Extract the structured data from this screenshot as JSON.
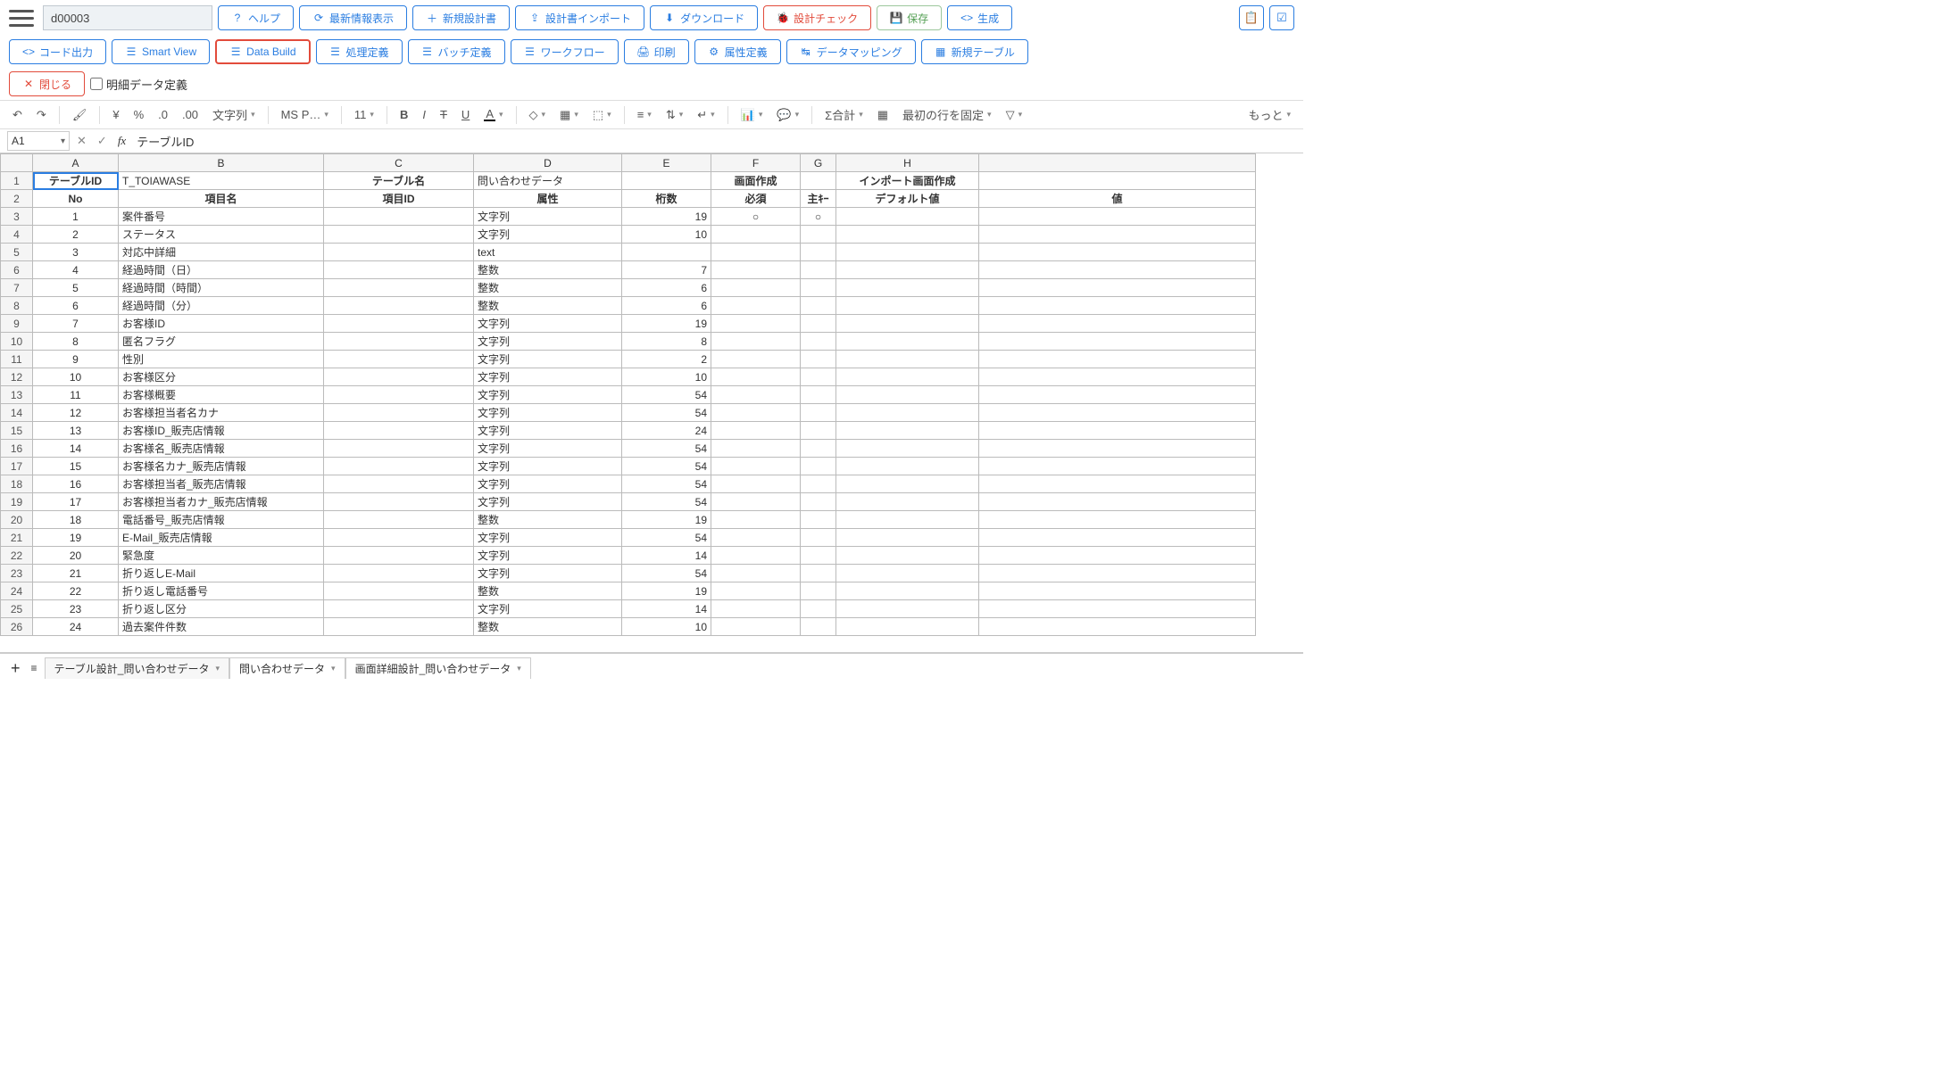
{
  "header": {
    "id_value": "d00003",
    "buttons": {
      "help": "ヘルプ",
      "refresh": "最新情報表示",
      "newdoc": "新規設計書",
      "import": "設計書インポート",
      "download": "ダウンロード",
      "check": "設計チェック",
      "save": "保存",
      "generate": "生成"
    }
  },
  "row2": {
    "buttons": {
      "codeout": "コード出力",
      "smartview": "Smart View",
      "databuild": "Data Build",
      "procdef": "処理定義",
      "batchdef": "バッチ定義",
      "workflow": "ワークフロー",
      "print": "印刷",
      "attrdef": "属性定義",
      "mapping": "データマッピング",
      "newtable": "新規テーブル",
      "close": "閉じる"
    },
    "checkbox": "明細データ定義"
  },
  "fmt": {
    "font": "文字列",
    "fontname": "MS P…",
    "size": "11",
    "sum": "Σ合計",
    "freeze": "最初の行を固定",
    "more": "もっと"
  },
  "fx": {
    "cell": "A1",
    "value": "テーブルID"
  },
  "grid": {
    "cols": [
      "A",
      "B",
      "C",
      "D",
      "E",
      "F",
      "G",
      "H"
    ],
    "headerRow1": {
      "A": "テーブルID",
      "B": "T_TOIAWASE",
      "C": "テーブル名",
      "D": "問い合わせデータ",
      "F": "画面作成",
      "H": "インポート画面作成"
    },
    "headerRow2": {
      "A": "No",
      "B": "項目名",
      "C": "項目ID",
      "D": "属性",
      "E": "桁数",
      "F": "必須",
      "G": "主ｷｰ",
      "H": "デフォルト値",
      "I": "値"
    },
    "rows": [
      {
        "no": "1",
        "name": "案件番号",
        "attr": "文字列",
        "digits": "19",
        "req": "○",
        "key": "○"
      },
      {
        "no": "2",
        "name": "ステータス",
        "attr": "文字列",
        "digits": "10"
      },
      {
        "no": "3",
        "name": "対応中詳細",
        "attr": "text"
      },
      {
        "no": "4",
        "name": "経過時間（日）",
        "attr": "整数",
        "digits": "7"
      },
      {
        "no": "5",
        "name": "経過時間（時間）",
        "attr": "整数",
        "digits": "6"
      },
      {
        "no": "6",
        "name": "経過時間（分）",
        "attr": "整数",
        "digits": "6"
      },
      {
        "no": "7",
        "name": "お客様ID",
        "attr": "文字列",
        "digits": "19"
      },
      {
        "no": "8",
        "name": "匿名フラグ",
        "attr": "文字列",
        "digits": "8"
      },
      {
        "no": "9",
        "name": "性別",
        "attr": "文字列",
        "digits": "2"
      },
      {
        "no": "10",
        "name": "お客様区分",
        "attr": "文字列",
        "digits": "10"
      },
      {
        "no": "11",
        "name": "お客様概要",
        "attr": "文字列",
        "digits": "54"
      },
      {
        "no": "12",
        "name": "お客様担当者名カナ",
        "attr": "文字列",
        "digits": "54"
      },
      {
        "no": "13",
        "name": "お客様ID_販売店情報",
        "attr": "文字列",
        "digits": "24"
      },
      {
        "no": "14",
        "name": "お客様名_販売店情報",
        "attr": "文字列",
        "digits": "54"
      },
      {
        "no": "15",
        "name": "お客様名カナ_販売店情報",
        "attr": "文字列",
        "digits": "54"
      },
      {
        "no": "16",
        "name": "お客様担当者_販売店情報",
        "attr": "文字列",
        "digits": "54"
      },
      {
        "no": "17",
        "name": "お客様担当者カナ_販売店情報",
        "attr": "文字列",
        "digits": "54"
      },
      {
        "no": "18",
        "name": "電話番号_販売店情報",
        "attr": "整数",
        "digits": "19"
      },
      {
        "no": "19",
        "name": "E-Mail_販売店情報",
        "attr": "文字列",
        "digits": "54"
      },
      {
        "no": "20",
        "name": "緊急度",
        "attr": "文字列",
        "digits": "14"
      },
      {
        "no": "21",
        "name": "折り返しE-Mail",
        "attr": "文字列",
        "digits": "54"
      },
      {
        "no": "22",
        "name": "折り返し電話番号",
        "attr": "整数",
        "digits": "19"
      },
      {
        "no": "23",
        "name": "折り返し区分",
        "attr": "文字列",
        "digits": "14"
      },
      {
        "no": "24",
        "name": "過去案件件数",
        "attr": "整数",
        "digits": "10"
      }
    ]
  },
  "tabs": [
    "テーブル設計_問い合わせデータ",
    "問い合わせデータ",
    "画面詳細設計_問い合わせデータ"
  ]
}
